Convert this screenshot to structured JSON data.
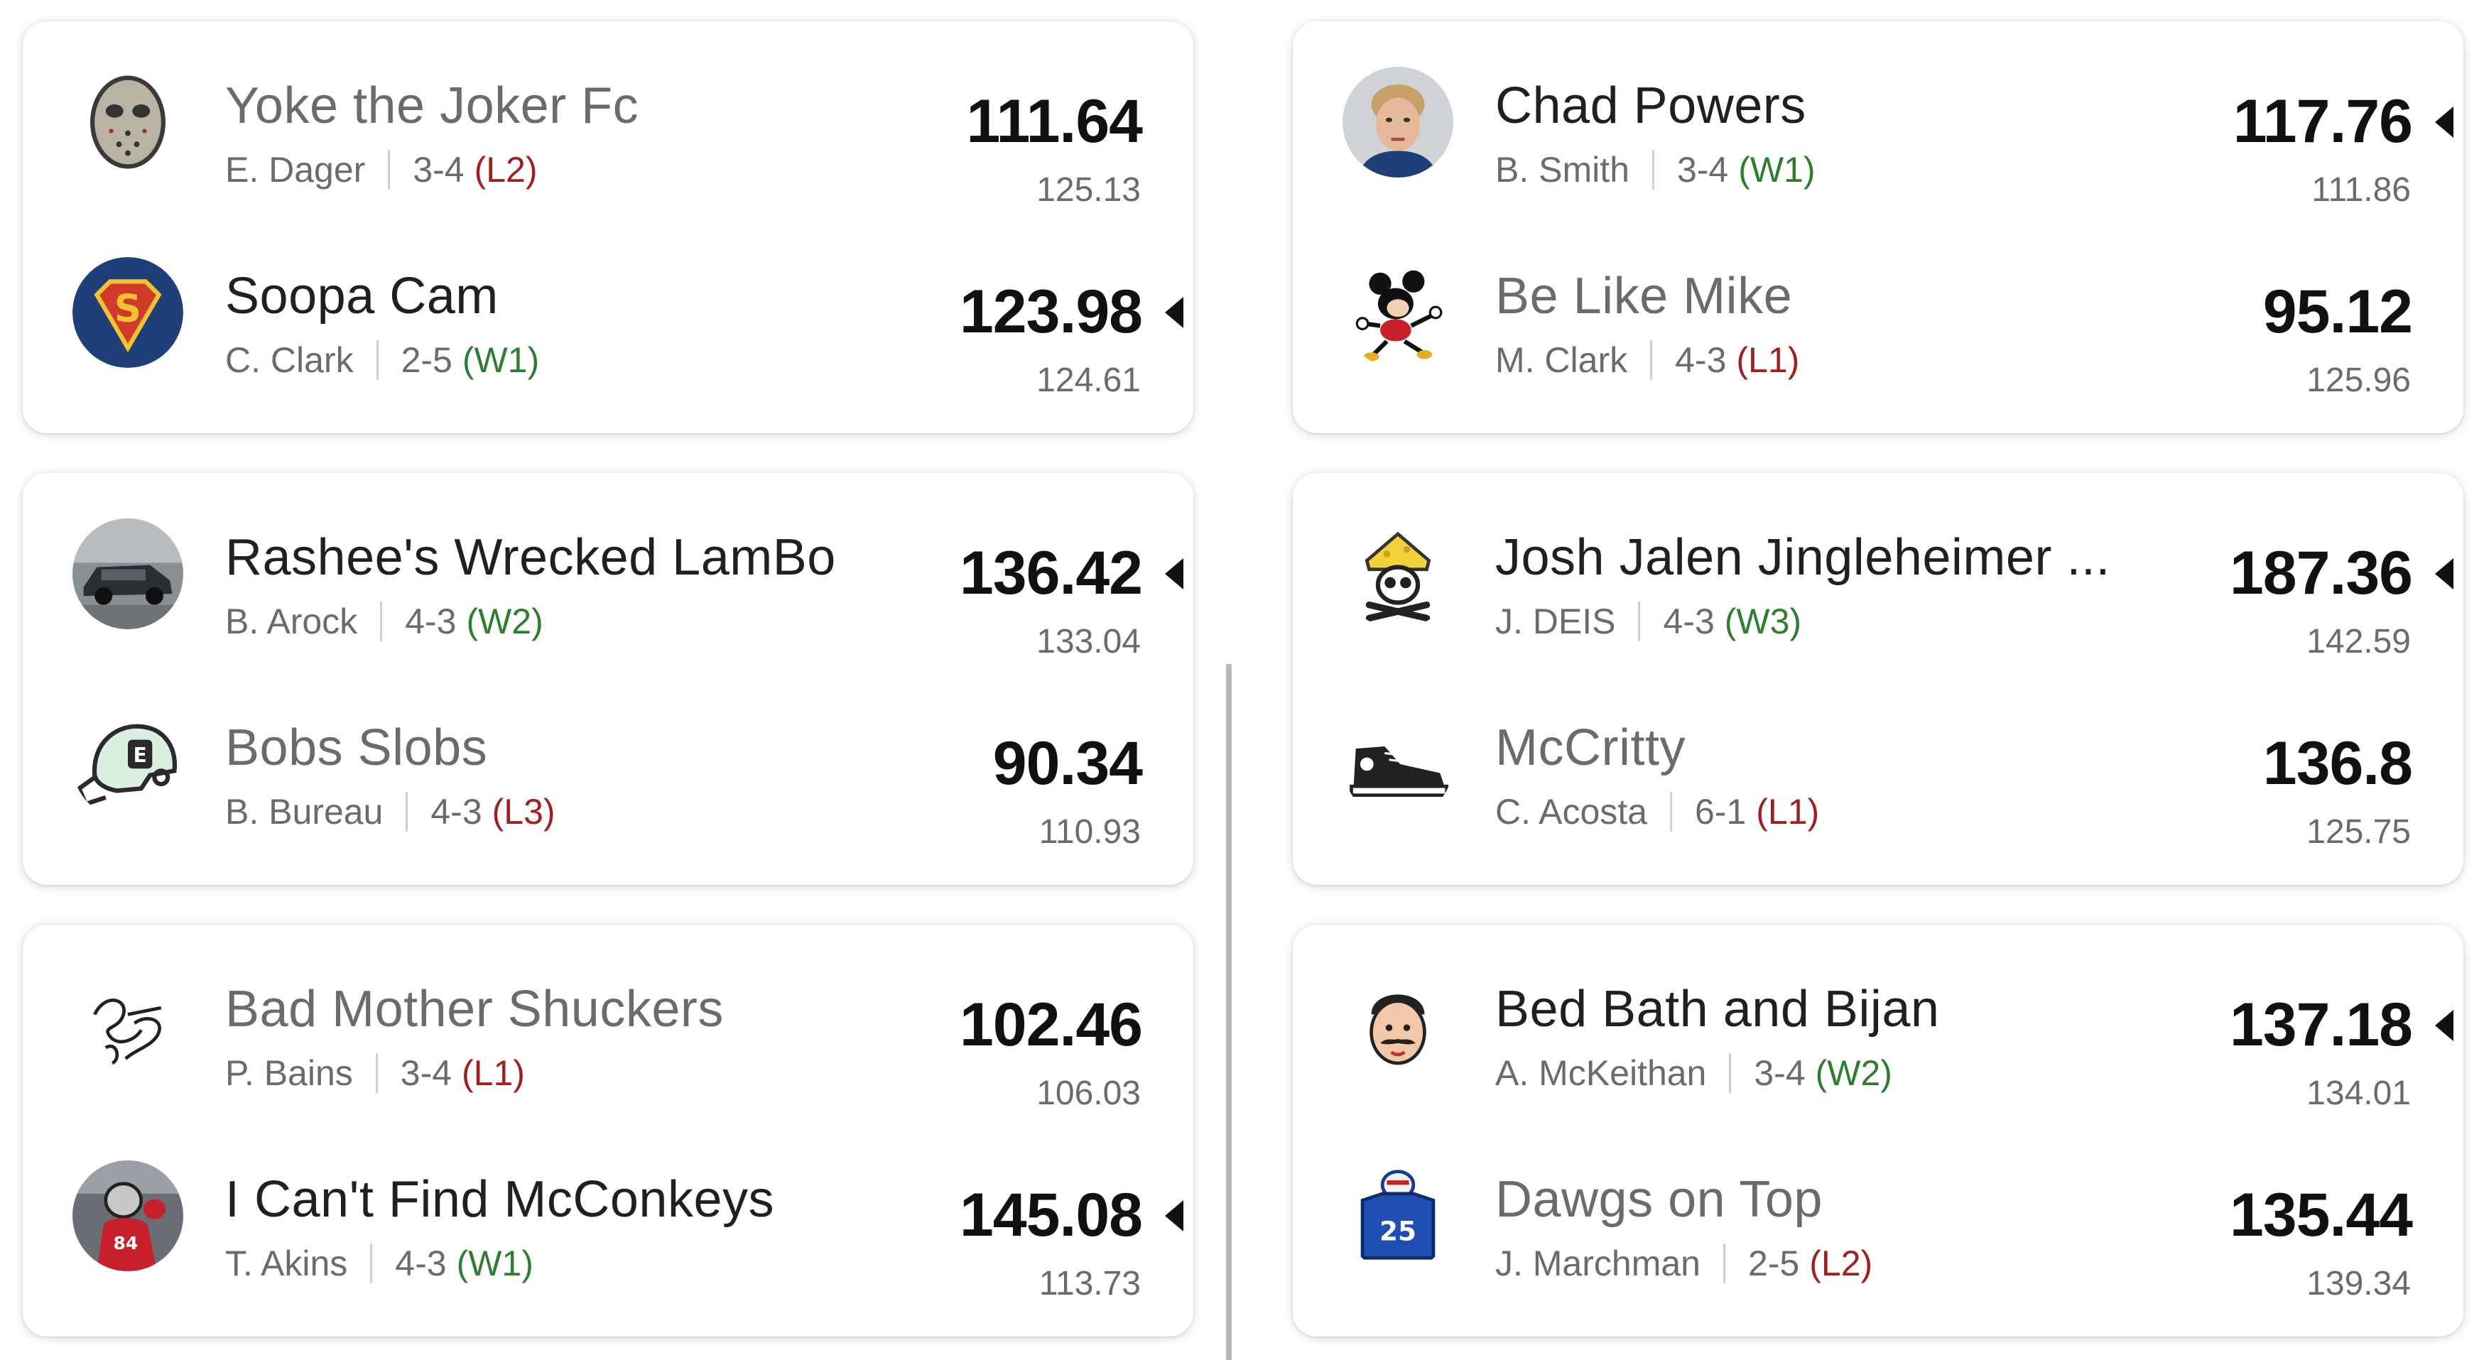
{
  "matchups": [
    {
      "top": {
        "name": "Yoke the Joker Fc",
        "owner": "E. Dager",
        "record": "3-4",
        "streak": "(L2)",
        "score": "111.64",
        "projected": "125.13"
      },
      "bottom": {
        "name": "Soopa Cam",
        "owner": "C. Clark",
        "record": "2-5",
        "streak": "(W1)",
        "score": "123.98",
        "projected": "124.61"
      }
    },
    {
      "top": {
        "name": "Rashee's Wrecked LamBo",
        "owner": "B. Arock",
        "record": "4-3",
        "streak": "(W2)",
        "score": "136.42",
        "projected": "133.04"
      },
      "bottom": {
        "name": "Bobs Slobs",
        "owner": "B. Bureau",
        "record": "4-3",
        "streak": "(L3)",
        "score": "90.34",
        "projected": "110.93"
      }
    },
    {
      "top": {
        "name": "Bad Mother Shuckers",
        "owner": "P. Bains",
        "record": "3-4",
        "streak": "(L1)",
        "score": "102.46",
        "projected": "106.03"
      },
      "bottom": {
        "name": "I Can't Find McConkeys",
        "owner": "T. Akins",
        "record": "4-3",
        "streak": "(W1)",
        "score": "145.08",
        "projected": "113.73"
      }
    },
    {
      "top": {
        "name": "Chad Powers",
        "owner": "B. Smith",
        "record": "3-4",
        "streak": "(W1)",
        "score": "117.76",
        "projected": "111.86"
      },
      "bottom": {
        "name": "Be Like Mike",
        "owner": "M. Clark",
        "record": "4-3",
        "streak": "(L1)",
        "score": "95.12",
        "projected": "125.96"
      }
    },
    {
      "top": {
        "name": "Josh Jalen Jingleheimer ...",
        "owner": "J. DEIS",
        "record": "4-3",
        "streak": "(W3)",
        "score": "187.36",
        "projected": "142.59"
      },
      "bottom": {
        "name": "McCritty",
        "owner": "C. Acosta",
        "record": "6-1",
        "streak": "(L1)",
        "score": "136.8",
        "projected": "125.75"
      }
    },
    {
      "top": {
        "name": "Bed Bath and Bijan",
        "owner": "A. McKeithan",
        "record": "3-4",
        "streak": "(W2)",
        "score": "137.18",
        "projected": "134.01"
      },
      "bottom": {
        "name": "Dawgs on Top",
        "owner": "J. Marchman",
        "record": "2-5",
        "streak": "(L2)",
        "score": "135.44",
        "projected": "139.34"
      }
    }
  ],
  "colors": {
    "win": "#2e7d32",
    "loss": "#a02020",
    "text": "#202020",
    "muted": "#6b6b6b"
  },
  "icons": [
    "hockey-mask-icon",
    "superman-shield-icon",
    "car-photo-avatar",
    "football-helmet-icon",
    "shuck-yeah-logo",
    "football-player-photo-avatar",
    "player-photo-avatar",
    "mickey-mouse-icon",
    "pirate-skull-icon",
    "sneaker-icon",
    "mustache-face-icon",
    "football-jersey-icon"
  ]
}
